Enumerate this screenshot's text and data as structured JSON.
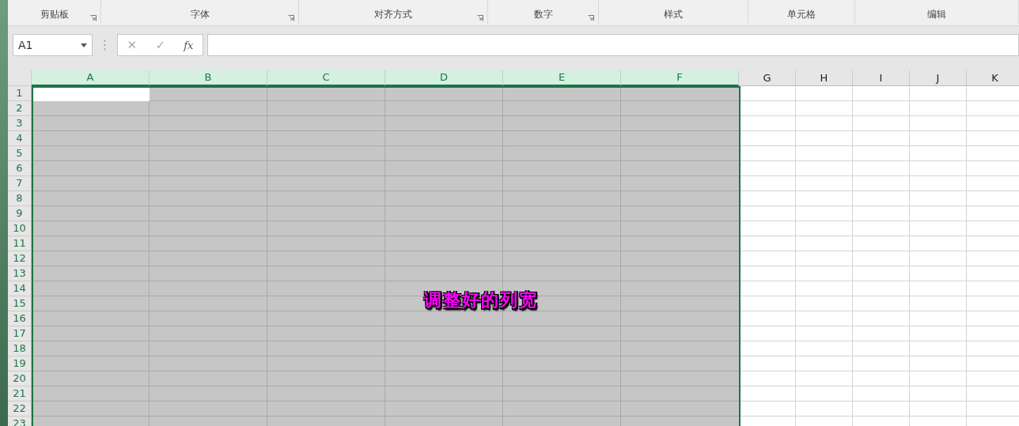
{
  "ribbon": {
    "groups": [
      {
        "label": "剪贴板",
        "launcher": true
      },
      {
        "label": "字体",
        "launcher": true
      },
      {
        "label": "对齐方式",
        "launcher": true
      },
      {
        "label": "数字",
        "launcher": true
      },
      {
        "label": "样式",
        "launcher": false
      },
      {
        "label": "单元格",
        "launcher": false
      },
      {
        "label": "编辑",
        "launcher": false
      }
    ]
  },
  "formula_bar": {
    "name_box": "A1",
    "grip": "⋮",
    "cancel": "✕",
    "enter": "✓",
    "function": "fx"
  },
  "sheet": {
    "columns": [
      {
        "label": "A",
        "selected": true
      },
      {
        "label": "B",
        "selected": true
      },
      {
        "label": "C",
        "selected": true
      },
      {
        "label": "D",
        "selected": true
      },
      {
        "label": "E",
        "selected": true
      },
      {
        "label": "F",
        "selected": true
      },
      {
        "label": "G",
        "selected": false
      },
      {
        "label": "H",
        "selected": false
      },
      {
        "label": "I",
        "selected": false
      },
      {
        "label": "J",
        "selected": false
      },
      {
        "label": "K",
        "selected": false
      }
    ],
    "rows": [
      {
        "label": "1",
        "active": true
      },
      {
        "label": "2",
        "active": false
      },
      {
        "label": "3",
        "active": false
      },
      {
        "label": "4",
        "active": false
      },
      {
        "label": "5",
        "active": false
      },
      {
        "label": "6",
        "active": false
      },
      {
        "label": "7",
        "active": false
      },
      {
        "label": "8",
        "active": false
      },
      {
        "label": "9",
        "active": false
      },
      {
        "label": "10",
        "active": false
      },
      {
        "label": "11",
        "active": false
      },
      {
        "label": "12",
        "active": false
      },
      {
        "label": "13",
        "active": false
      },
      {
        "label": "14",
        "active": false
      },
      {
        "label": "15",
        "active": false
      },
      {
        "label": "16",
        "active": false
      },
      {
        "label": "17",
        "active": false
      },
      {
        "label": "18",
        "active": false
      },
      {
        "label": "19",
        "active": false
      },
      {
        "label": "20",
        "active": false
      },
      {
        "label": "21",
        "active": false
      },
      {
        "label": "22",
        "active": false
      },
      {
        "label": "23",
        "active": false
      }
    ]
  },
  "caption": "调整好的列宽"
}
